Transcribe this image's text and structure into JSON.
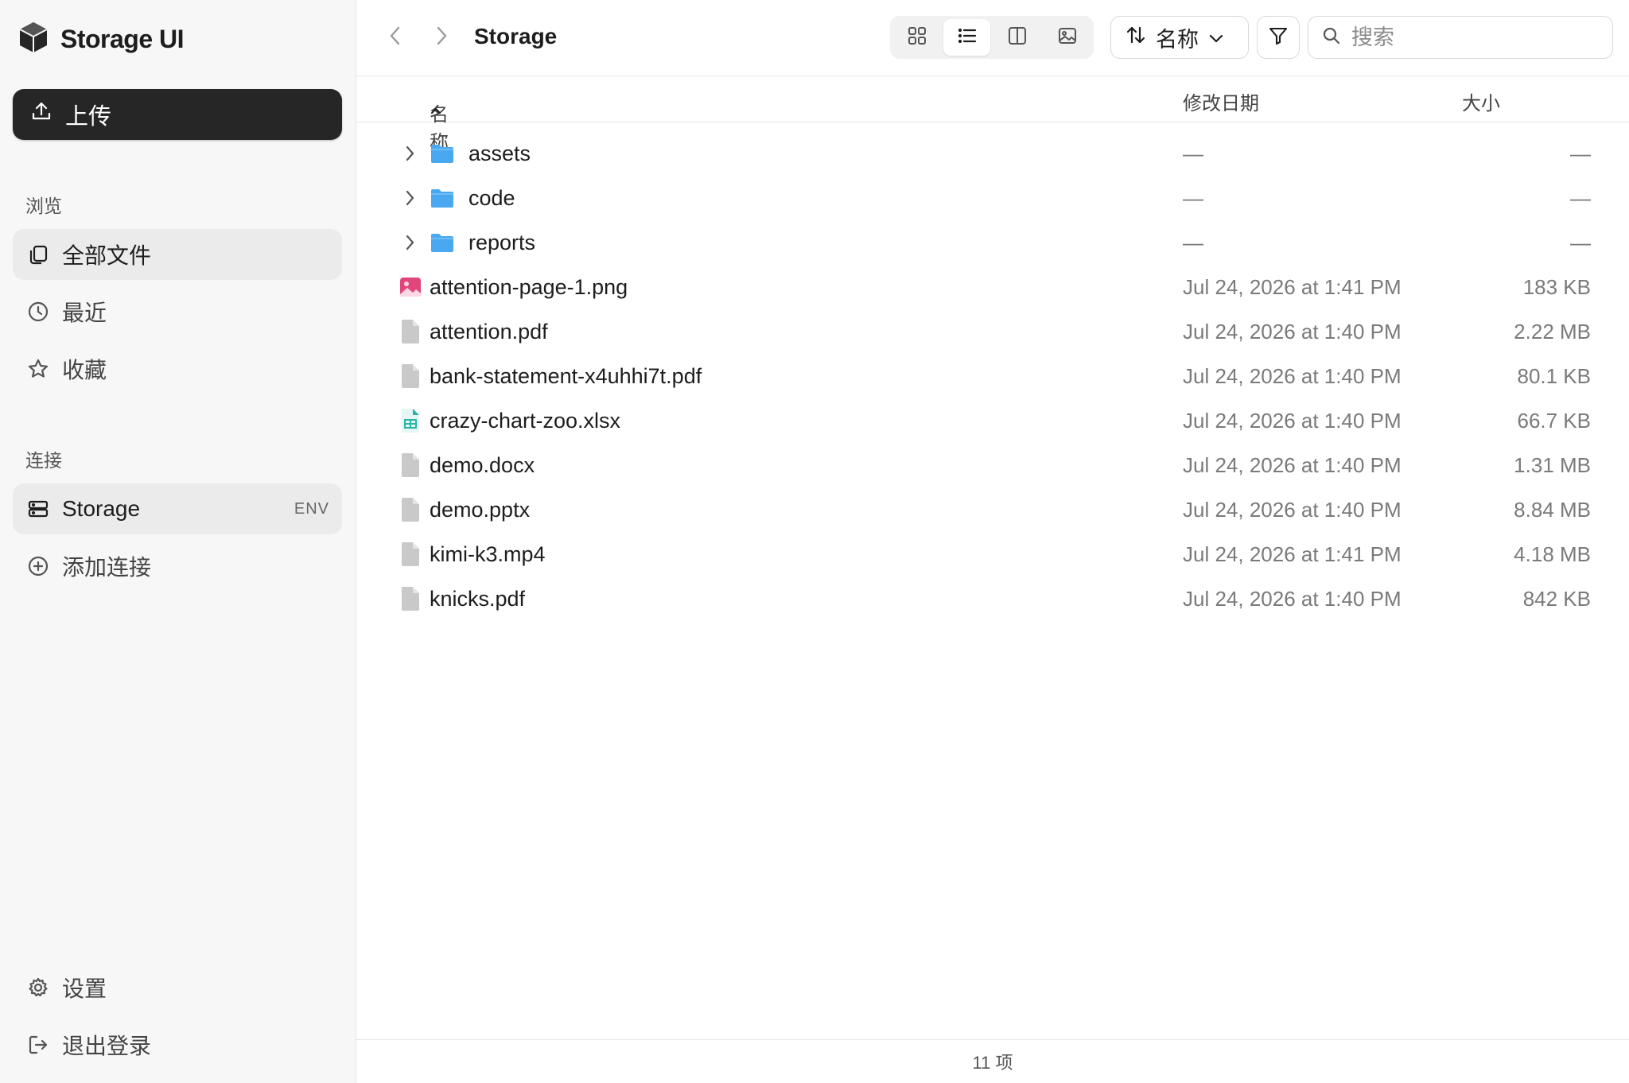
{
  "app": {
    "title": "Storage UI"
  },
  "sidebar": {
    "upload_label": "上传",
    "browse_section": "浏览",
    "browse_items": [
      {
        "label": "全部文件",
        "icon": "files-icon",
        "active": true
      },
      {
        "label": "最近",
        "icon": "clock-icon",
        "active": false
      },
      {
        "label": "收藏",
        "icon": "star-icon",
        "active": false
      }
    ],
    "connect_section": "连接",
    "connections": [
      {
        "label": "Storage",
        "badge": "ENV",
        "icon": "storage-icon",
        "active": true
      }
    ],
    "add_connection": "添加连接",
    "settings": "设置",
    "logout": "退出登录"
  },
  "toolbar": {
    "breadcrumb": "Storage",
    "view_modes": [
      "grid",
      "list",
      "columns",
      "gallery"
    ],
    "active_view": "list",
    "sort_label": "名称",
    "search_placeholder": "搜索"
  },
  "table": {
    "columns": {
      "name": "名称",
      "modified": "修改日期",
      "size": "大小"
    },
    "rows": [
      {
        "name": "assets",
        "type": "folder",
        "modified": "—",
        "size": "—"
      },
      {
        "name": "code",
        "type": "folder",
        "modified": "—",
        "size": "—"
      },
      {
        "name": "reports",
        "type": "folder",
        "modified": "—",
        "size": "—"
      },
      {
        "name": "attention-page-1.png",
        "type": "image",
        "modified": "Jul 24, 2026 at 1:41 PM",
        "size": "183 KB"
      },
      {
        "name": "attention.pdf",
        "type": "file",
        "modified": "Jul 24, 2026 at 1:40 PM",
        "size": "2.22 MB"
      },
      {
        "name": "bank-statement-x4uhhi7t.pdf",
        "type": "file",
        "modified": "Jul 24, 2026 at 1:40 PM",
        "size": "80.1 KB"
      },
      {
        "name": "crazy-chart-zoo.xlsx",
        "type": "spreadsheet",
        "modified": "Jul 24, 2026 at 1:40 PM",
        "size": "66.7 KB"
      },
      {
        "name": "demo.docx",
        "type": "file",
        "modified": "Jul 24, 2026 at 1:40 PM",
        "size": "1.31 MB"
      },
      {
        "name": "demo.pptx",
        "type": "file",
        "modified": "Jul 24, 2026 at 1:40 PM",
        "size": "8.84 MB"
      },
      {
        "name": "kimi-k3.mp4",
        "type": "file",
        "modified": "Jul 24, 2026 at 1:41 PM",
        "size": "4.18 MB"
      },
      {
        "name": "knicks.pdf",
        "type": "file",
        "modified": "Jul 24, 2026 at 1:40 PM",
        "size": "842 KB"
      }
    ]
  },
  "status": {
    "item_count": "11 项"
  },
  "colors": {
    "folder": "#4aa8f0",
    "image": "#e0457b",
    "spreadsheet": "#2bb5a8",
    "file": "#c9c9c9",
    "upload_bg": "#262626"
  }
}
